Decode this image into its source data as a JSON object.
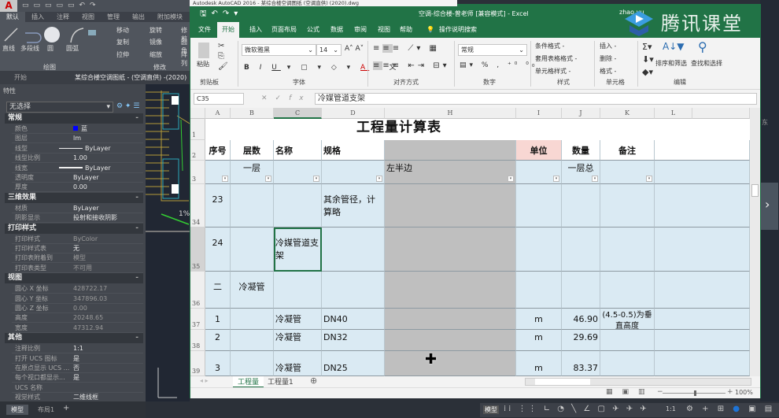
{
  "autocad": {
    "qat_icons": [
      "new-icon",
      "open-icon",
      "save-icon",
      "saveas-icon",
      "print-icon",
      "undo-icon",
      "redo-icon"
    ],
    "title_text": "Autodesk AutoCAD 2016 - 某综合楼空调图纸 (空调直供) (2020).dwg",
    "tabs": [
      "默认",
      "插入",
      "注释",
      "视图",
      "管理",
      "输出",
      "附加模块"
    ],
    "draw_tools": [
      "直线",
      "多段线",
      "圆",
      "圆弧"
    ],
    "modify_tools": [
      "移动",
      "旋转",
      "修剪",
      "复制",
      "镜像",
      "圆角",
      "拉伸",
      "缩放",
      "阵列"
    ],
    "panel_draw": "绘图",
    "panel_modify": "修改",
    "doc_tabs": [
      "开始",
      "某综合楼空调图纸 - (空调直供) -(2020)"
    ],
    "props_title": "特性",
    "selection": "无选择",
    "sections": [
      {
        "title": "常规",
        "rows": [
          [
            "颜色",
            "蓝"
          ],
          [
            "图层",
            "lm"
          ],
          [
            "线型",
            "ByLayer"
          ],
          [
            "线型比例",
            "1.00"
          ],
          [
            "线宽",
            "ByLayer"
          ],
          [
            "透明度",
            "ByLayer"
          ],
          [
            "厚度",
            "0.00"
          ]
        ]
      },
      {
        "title": "三维效果",
        "rows": [
          [
            "材质",
            "ByLayer"
          ],
          [
            "阴影显示",
            "投射和接收阴影"
          ]
        ]
      },
      {
        "title": "打印样式",
        "rows": [
          [
            "打印样式",
            "ByColor"
          ],
          [
            "打印样式表",
            "无"
          ],
          [
            "打印表附着到",
            "模型"
          ],
          [
            "打印表类型",
            "不可用"
          ]
        ]
      },
      {
        "title": "视图",
        "rows": [
          [
            "圆心 X 坐标",
            "428722.17"
          ],
          [
            "圆心 Y 坐标",
            "347896.03"
          ],
          [
            "圆心 Z 坐标",
            "0.00"
          ],
          [
            "高度",
            "20248.65"
          ],
          [
            "宽度",
            "47312.94"
          ]
        ]
      },
      {
        "title": "其他",
        "rows": [
          [
            "注释比例",
            "1:1"
          ],
          [
            "打开 UCS 图标",
            "是"
          ],
          [
            "在原点显示 UCS ...",
            "否"
          ],
          [
            "每个视口都显示...",
            "是"
          ],
          [
            "UCS 名称",
            ""
          ],
          [
            "视觉样式",
            "二维线框"
          ]
        ]
      }
    ],
    "layout_tabs": [
      "模型",
      "布局1"
    ],
    "status_model": "模型",
    "status_scale": "1:1",
    "drawing_text": "1%",
    "viewcube_label": "东",
    "accent_color": "#0000ff"
  },
  "excel": {
    "title": "空调-综合楼-曾老师 [兼容模式] - Excel",
    "user": "zhao yu",
    "menu_tabs": [
      "文件",
      "开始",
      "插入",
      "页面布局",
      "公式",
      "数据",
      "审阅",
      "视图",
      "帮助"
    ],
    "tell_me": "操作说明搜索",
    "ribbon": {
      "paste": "粘贴",
      "clipboard": "剪贴板",
      "font_name": "微软雅黑",
      "font_size": "14",
      "font_group": "字体",
      "align_group": "对齐方式",
      "number_format": "常规",
      "number_group": "数字",
      "styles": [
        "条件格式 -",
        "套用表格格式 -",
        "单元格样式 -"
      ],
      "styles_group": "样式",
      "cells": [
        "插入 -",
        "删除 -",
        "格式 -"
      ],
      "cells_group": "单元格",
      "sort": "排序和筛选",
      "find": "查找和选择",
      "edit_group": "编辑"
    },
    "name_box": "C35",
    "formula": "冷媒管道支架",
    "columns": [
      "A",
      "B",
      "C",
      "D",
      "H",
      "I",
      "J",
      "K",
      "L"
    ],
    "title_cell": "工程量计算表",
    "rows": [
      {
        "num": "1",
        "cells": [
          "",
          "",
          "",
          "",
          "",
          "",
          "",
          "",
          ""
        ]
      },
      {
        "num": "2",
        "cells": [
          "序号",
          "层数",
          "名称",
          "规格",
          "",
          "单位",
          "数量",
          "备注",
          ""
        ]
      },
      {
        "num": "3",
        "cells": [
          "",
          "一层",
          "",
          "",
          "左半边",
          "",
          "一层总",
          "",
          ""
        ]
      },
      {
        "num": "34",
        "cells": [
          "23",
          "",
          "",
          "其余管径，计算略",
          "",
          "",
          "",
          "",
          ""
        ]
      },
      {
        "num": "35",
        "cells": [
          "24",
          "",
          "冷媒管道支架",
          "",
          "",
          "",
          "",
          "",
          ""
        ]
      },
      {
        "num": "36",
        "cells": [
          "二",
          "冷凝管",
          "",
          "",
          "",
          "",
          "",
          "",
          ""
        ]
      },
      {
        "num": "37",
        "cells": [
          "1",
          "",
          "冷凝管",
          "DN40",
          "",
          "m",
          "46.90",
          "(4.5-0.5)为垂直高度",
          ""
        ]
      },
      {
        "num": "38",
        "cells": [
          "2",
          "",
          "冷凝管",
          "DN32",
          "",
          "m",
          "29.69",
          "",
          ""
        ]
      },
      {
        "num": "39",
        "cells": [
          "3",
          "",
          "冷凝管",
          "DN25",
          "",
          "m",
          "83.37",
          "",
          ""
        ]
      }
    ],
    "selected_cell": "C35",
    "sheet_tabs": [
      "工程量",
      "工程量1"
    ],
    "active_sheet": "工程量",
    "zoom": "100%",
    "colors": {
      "brand": "#217346",
      "filter_row": "#daeaf3",
      "hidden_col": "#bfbfbf",
      "unit_header": "#f8d7d3"
    }
  },
  "watermark": "腾讯课堂"
}
